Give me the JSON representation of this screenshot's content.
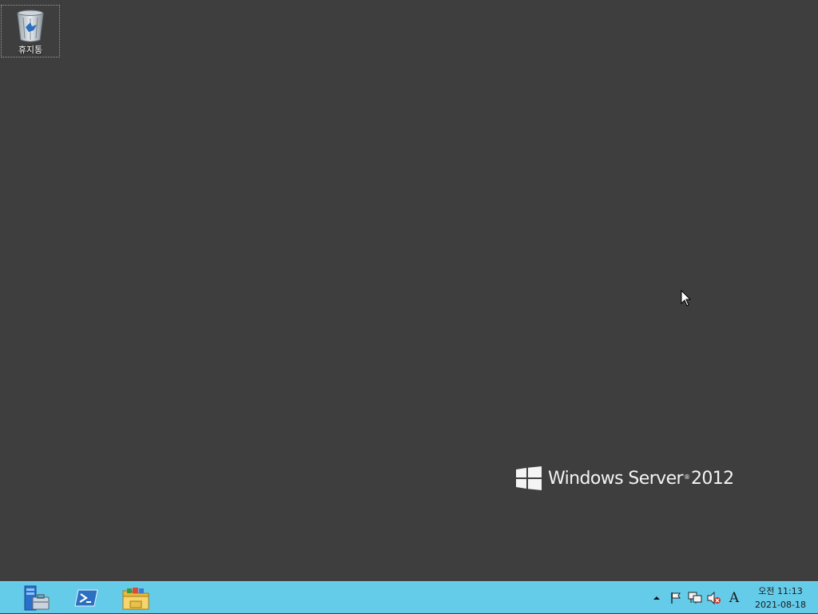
{
  "desktop": {
    "recycle_bin_label": "휴지통",
    "background_color": "#3e3e3e"
  },
  "branding": {
    "product_name": "Windows Server",
    "trademark": "®",
    "version": "2012"
  },
  "taskbar": {
    "color": "#64cbe9",
    "pinned": [
      {
        "name": "server-manager-icon"
      },
      {
        "name": "powershell-icon"
      },
      {
        "name": "file-explorer-icon"
      }
    ],
    "tray_icons": [
      "show-hidden-icons-chevron",
      "action-center-flag-icon",
      "network-icon",
      "volume-muted-icon",
      "ime-language-icon"
    ],
    "ime_label": "A",
    "clock": {
      "time": "오전 11:13",
      "date": "2021-08-18"
    }
  }
}
